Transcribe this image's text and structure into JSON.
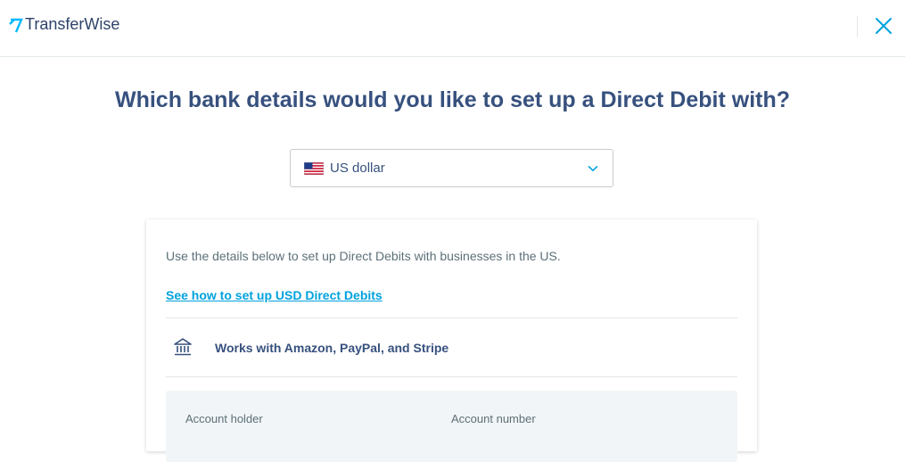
{
  "header": {
    "brand_name": "TransferWise",
    "logo_icon": "transferwise-flag-icon",
    "close_icon": "close-icon",
    "accent_color": "#00b9ff"
  },
  "main": {
    "title": "Which bank details would you like to set up a Direct Debit with?",
    "currency_select": {
      "selected_value": "US dollar",
      "flag_icon": "us-flag-icon",
      "chevron_icon": "chevron-down-icon"
    },
    "card": {
      "intro_text": "Use the details below to set up Direct Debits with businesses in the US.",
      "help_link": "See how to set up USD Direct Debits",
      "works_with_text": "Works with Amazon, PayPal, and Stripe",
      "bank_icon": "bank-icon",
      "details": {
        "account_holder_label": "Account holder",
        "account_number_label": "Account number"
      }
    }
  }
}
